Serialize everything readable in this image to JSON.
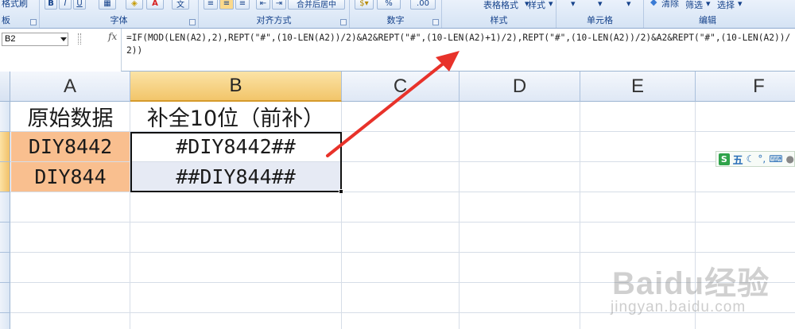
{
  "ribbon": {
    "paste_label": "格式刷",
    "clipboard_group_fragment": "板",
    "font_group": "字体",
    "align_group": "对齐方式",
    "merge_label": "合并后居中",
    "number_group": "数字",
    "styles_group": "样式",
    "table_format_label": "表格格式",
    "cell_style_label": "样式",
    "cells_group": "单元格",
    "edit_group": "编辑",
    "clear_label": "清除",
    "filter_label": "筛选",
    "select_label": "选择",
    "bold_label": "B",
    "italic_label": "I",
    "percent_label": "%",
    "decimal_label": ".00",
    "wen_label": "文"
  },
  "formula_bar": {
    "name_box": "B2",
    "fx_label": "fx",
    "formula": "=IF(MOD(LEN(A2),2),REPT(\"#\",(10-LEN(A2))/2)&A2&REPT(\"#\",(10-LEN(A2)+1)/2),REPT(\"#\",(10-LEN(A2))/2)&A2&REPT(\"#\",(10-LEN(A2))/2))"
  },
  "columns": [
    "A",
    "B",
    "C",
    "D",
    "E",
    "F"
  ],
  "active_column": "B",
  "cells": {
    "a1": "原始数据",
    "b1": "补全10位（前补）",
    "a2": "DIY8442",
    "b2": "#DIY8442##",
    "a3": "DIY844",
    "b3": "##DIY844##"
  },
  "colors": {
    "source_fill": "#f9bf8f",
    "selection_fill": "#e6eaf4",
    "arrow": "#e8322a",
    "header_active": "#f2c56a"
  },
  "ime": {
    "logo": "S",
    "mode": "五",
    "icons": [
      "moon-icon",
      "punctuation-icon",
      "keyboard-icon",
      "user-icon"
    ]
  },
  "watermark": {
    "brand": "Baidu经验",
    "url": "jingyan.baidu.com"
  }
}
